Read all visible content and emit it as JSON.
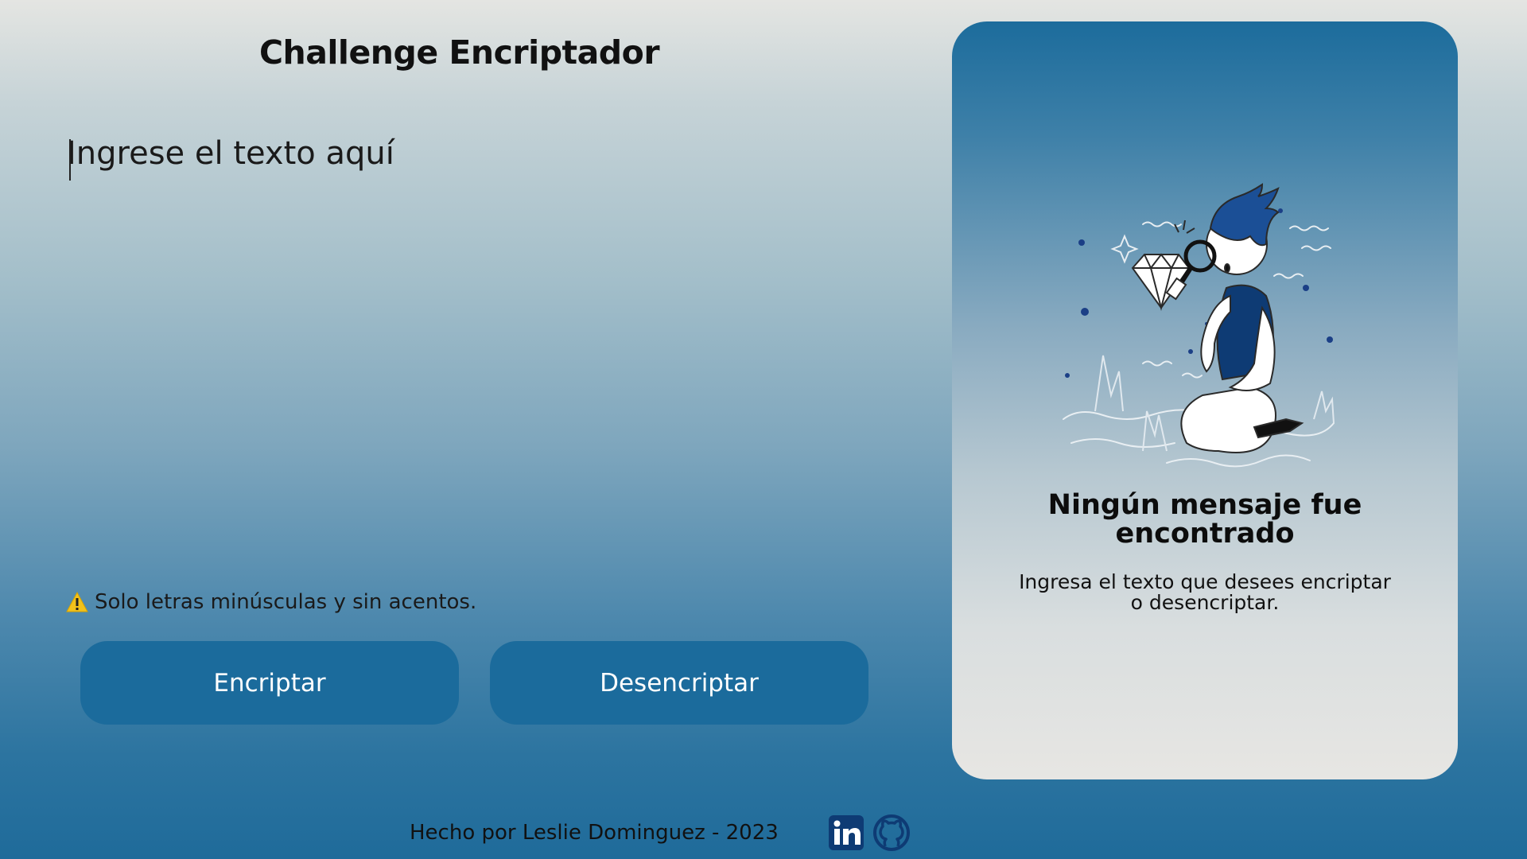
{
  "header": {
    "title": "Challenge Encriptador"
  },
  "input": {
    "placeholder": "Ingrese el texto aquí",
    "value": ""
  },
  "warning": {
    "icon": "warning-icon",
    "text": "Solo letras minúsculas y sin acentos."
  },
  "actions": {
    "encrypt_label": "Encriptar",
    "decrypt_label": "Desencriptar"
  },
  "output": {
    "illustration": "person-with-magnifying-glass-illustration",
    "title_line1": "Ningún mensaje fue",
    "title_line2": "encontrado",
    "desc_line1": "Ingresa el texto que desees encriptar",
    "desc_line2": "o desencriptar."
  },
  "footer": {
    "credit": "Hecho por Leslie Dominguez - 2023",
    "links": [
      {
        "icon": "linkedin-icon"
      },
      {
        "icon": "github-icon"
      }
    ]
  },
  "colors": {
    "accent": "#1b6b9c",
    "linkedin": "#0e3b74",
    "github": "#0e3b74"
  }
}
